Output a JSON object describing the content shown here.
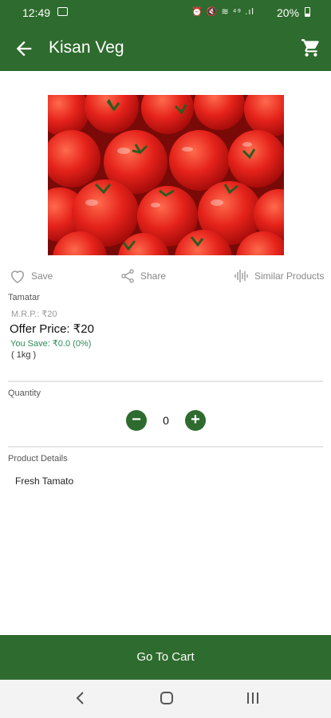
{
  "status_bar": {
    "time": "12:49",
    "icons_text": "⏰ 🔇 ≋ ⁴⁹ .ıl",
    "battery": "20%"
  },
  "app_bar": {
    "title": "Kisan Veg"
  },
  "actions": {
    "save": "Save",
    "share": "Share",
    "similar": "Similar Products"
  },
  "product": {
    "name": "Tamatar",
    "mrp": "M.R.P.: ₹20",
    "offer_price": "Offer Price: ₹20",
    "you_save": "You Save: ₹0.0 (0%)",
    "unit": "( 1kg )"
  },
  "quantity": {
    "label": "Quantity",
    "value": "0"
  },
  "details": {
    "label": "Product Details",
    "text": "Fresh Tamato"
  },
  "footer": {
    "go_to_cart": "Go To Cart"
  },
  "colors": {
    "primary": "#2e6b2e",
    "save_text": "#2e8b57"
  }
}
